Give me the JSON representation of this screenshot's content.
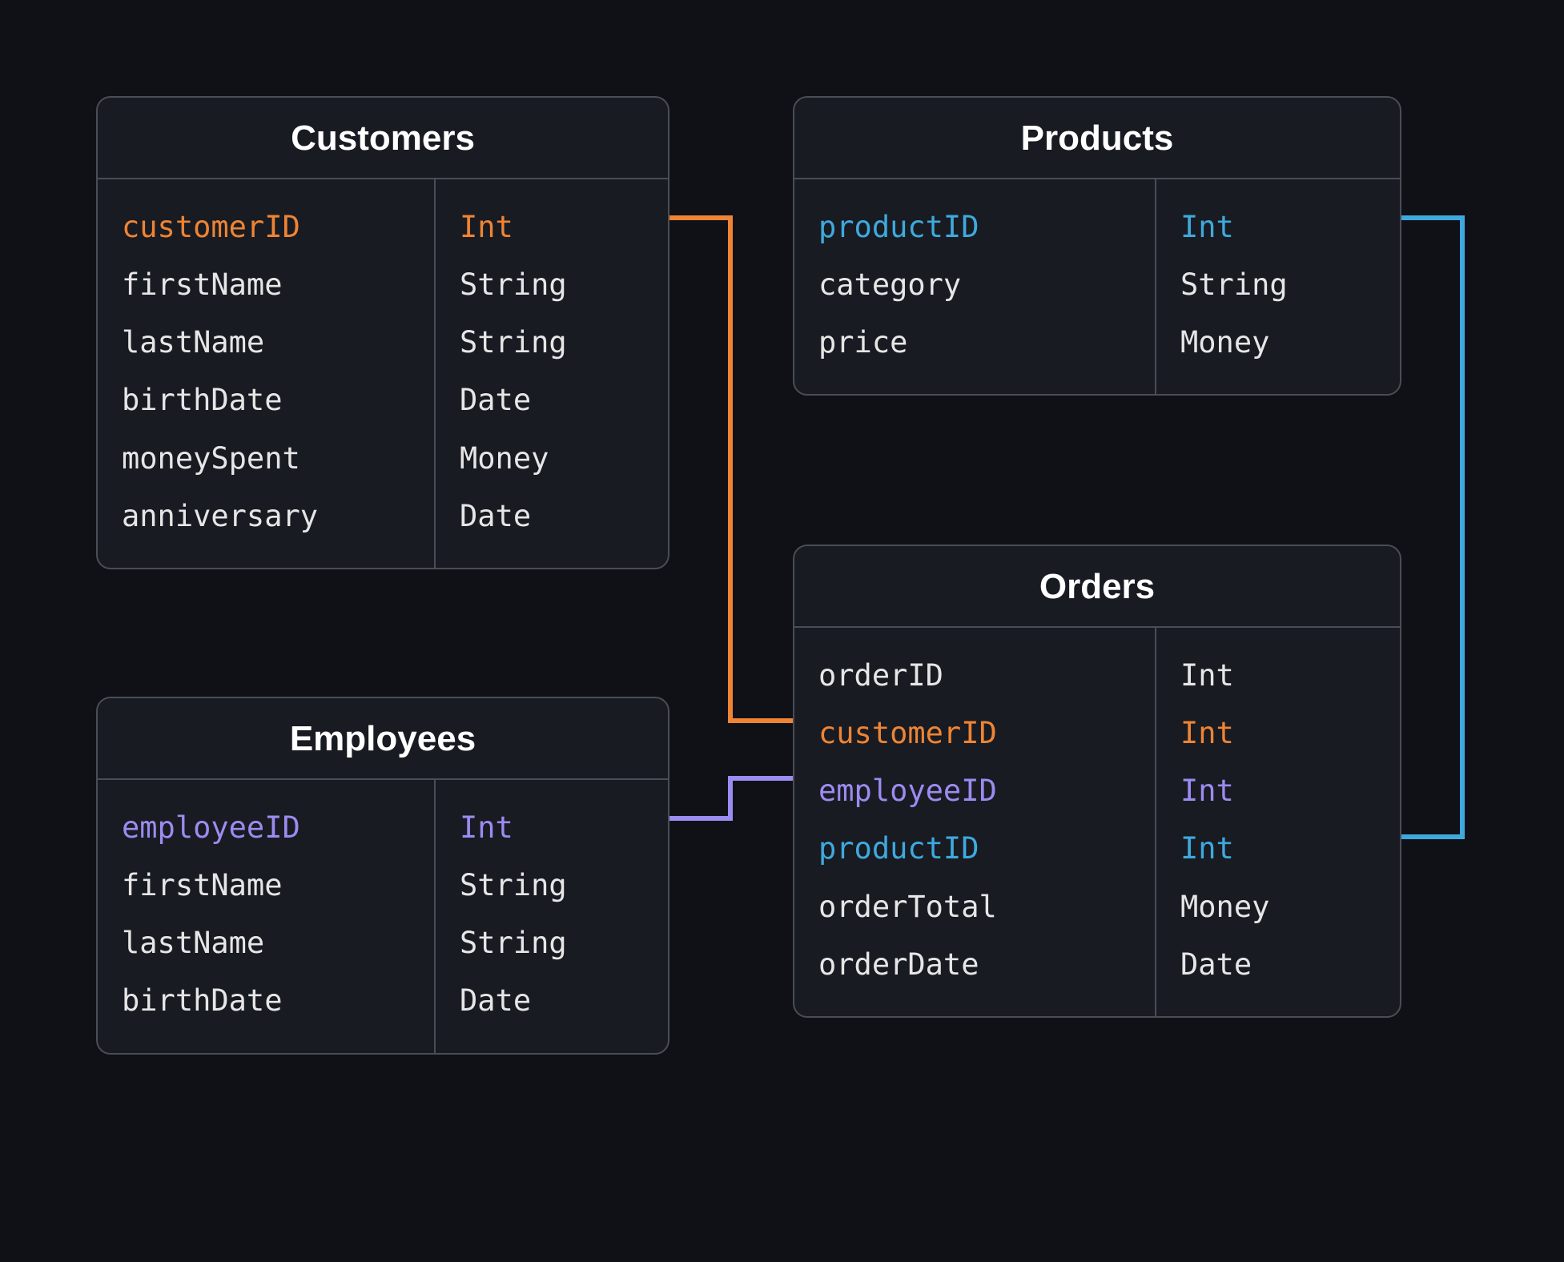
{
  "colors": {
    "orange": "#ee8434",
    "blue": "#3fa9dd",
    "purple": "#9a8cf0",
    "default": "#e6e6e6",
    "border": "#4a4d55",
    "bg": "#0f1117",
    "card_bg": "#181b22"
  },
  "tables": {
    "customers": {
      "title": "Customers",
      "fields": [
        {
          "name": "customerID",
          "type": "Int",
          "color": "orange"
        },
        {
          "name": "firstName",
          "type": "String",
          "color": "default"
        },
        {
          "name": "lastName",
          "type": "String",
          "color": "default"
        },
        {
          "name": "birthDate",
          "type": "Date",
          "color": "default"
        },
        {
          "name": "moneySpent",
          "type": "Money",
          "color": "default"
        },
        {
          "name": "anniversary",
          "type": "Date",
          "color": "default"
        }
      ]
    },
    "products": {
      "title": "Products",
      "fields": [
        {
          "name": "productID",
          "type": "Int",
          "color": "blue"
        },
        {
          "name": "category",
          "type": "String",
          "color": "default"
        },
        {
          "name": "price",
          "type": "Money",
          "color": "default"
        }
      ]
    },
    "employees": {
      "title": "Employees",
      "fields": [
        {
          "name": "employeeID",
          "type": "Int",
          "color": "purple"
        },
        {
          "name": "firstName",
          "type": "String",
          "color": "default"
        },
        {
          "name": "lastName",
          "type": "String",
          "color": "default"
        },
        {
          "name": "birthDate",
          "type": "Date",
          "color": "default"
        }
      ]
    },
    "orders": {
      "title": "Orders",
      "fields": [
        {
          "name": "orderID",
          "type": "Int",
          "color": "default"
        },
        {
          "name": "customerID",
          "type": "Int",
          "color": "orange"
        },
        {
          "name": "employeeID",
          "type": "Int",
          "color": "purple"
        },
        {
          "name": "productID",
          "type": "Int",
          "color": "blue"
        },
        {
          "name": "orderTotal",
          "type": "Money",
          "color": "default"
        },
        {
          "name": "orderDate",
          "type": "Date",
          "color": "default"
        }
      ]
    }
  },
  "relationships": [
    {
      "from": "customers.customerID",
      "to": "orders.customerID",
      "color": "orange"
    },
    {
      "from": "employees.employeeID",
      "to": "orders.employeeID",
      "color": "purple"
    },
    {
      "from": "products.productID",
      "to": "orders.productID",
      "color": "blue"
    }
  ]
}
